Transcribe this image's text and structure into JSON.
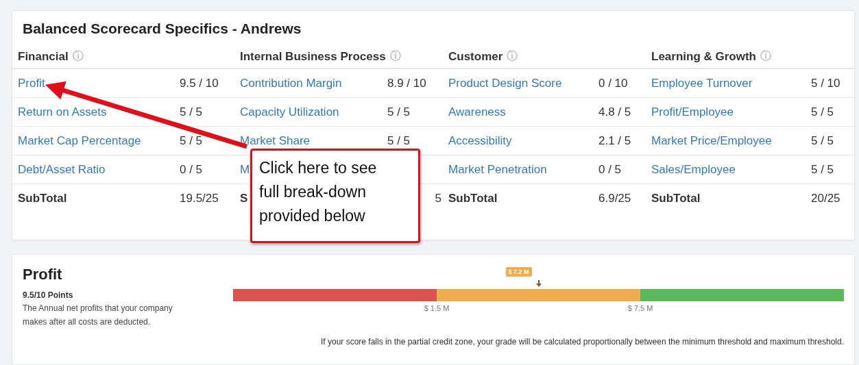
{
  "scorecard": {
    "title": "Balanced Scorecard Specifics - Andrews",
    "categories": [
      {
        "name": "Financial",
        "info": "ⓘ",
        "metrics": [
          {
            "name": "Profit",
            "score": "9.5 / 10"
          },
          {
            "name": "Return on Assets",
            "score": "5 / 5"
          },
          {
            "name": "Market Cap Percentage",
            "score": "5 / 5"
          },
          {
            "name": "Debt/Asset Ratio",
            "score": "0 / 5"
          }
        ],
        "subtotal": {
          "label": "SubTotal",
          "value": "19.5/25",
          "clipped": false
        }
      },
      {
        "name": "Internal Business Process",
        "info": "ⓘ",
        "metrics": [
          {
            "name": "Contribution Margin",
            "score": "8.9 / 10"
          },
          {
            "name": "Capacity Utilization",
            "score": "5 / 5"
          },
          {
            "name": "Market Share",
            "score": "5 / 5"
          },
          {
            "name": "M"
          }
        ],
        "subtotal": {
          "label": "S",
          "value": "5",
          "clipped": true
        }
      },
      {
        "name": "Customer",
        "info": "ⓘ",
        "metrics": [
          {
            "name": "Product Design Score",
            "score": "0 / 10"
          },
          {
            "name": "Awareness",
            "score": "4.8 / 5"
          },
          {
            "name": "Accessibility",
            "score": "2.1 / 5"
          },
          {
            "name": "Market Penetration",
            "score": "0 / 5"
          }
        ],
        "subtotal": {
          "label": "SubTotal",
          "value": "6.9/25",
          "clipped": false
        }
      },
      {
        "name": "Learning & Growth",
        "info": "ⓘ",
        "metrics": [
          {
            "name": "Employee Turnover",
            "score": "5 / 10"
          },
          {
            "name": "Profit/Employee",
            "score": "5 / 5"
          },
          {
            "name": "Market Price/Employee",
            "score": "5 / 5"
          },
          {
            "name": "Sales/Employee",
            "score": "5 / 5"
          }
        ],
        "subtotal": {
          "label": "SubTotal",
          "value": "20/25",
          "clipped": false
        }
      }
    ]
  },
  "detail": {
    "title": "Profit",
    "points": "9.5/10 Points",
    "description": "The Annual net profits that your company makes after all costs are deducted.",
    "gauge": {
      "segments": [
        {
          "color": "#d9534f"
        },
        {
          "color": "#f0ad4e"
        },
        {
          "color": "#5cb85c"
        }
      ],
      "ticks": [
        "$ 1.5 M",
        "$ 7.5 M"
      ],
      "marker": {
        "label": "$ 7.2 M"
      }
    },
    "note": "If your score falls in the partial credit zone, your grade will be calculated proportionally between the minimum threshold and maximum threshold."
  },
  "callout": {
    "text": "Click here to see\nfull break-down\nprovided below"
  }
}
